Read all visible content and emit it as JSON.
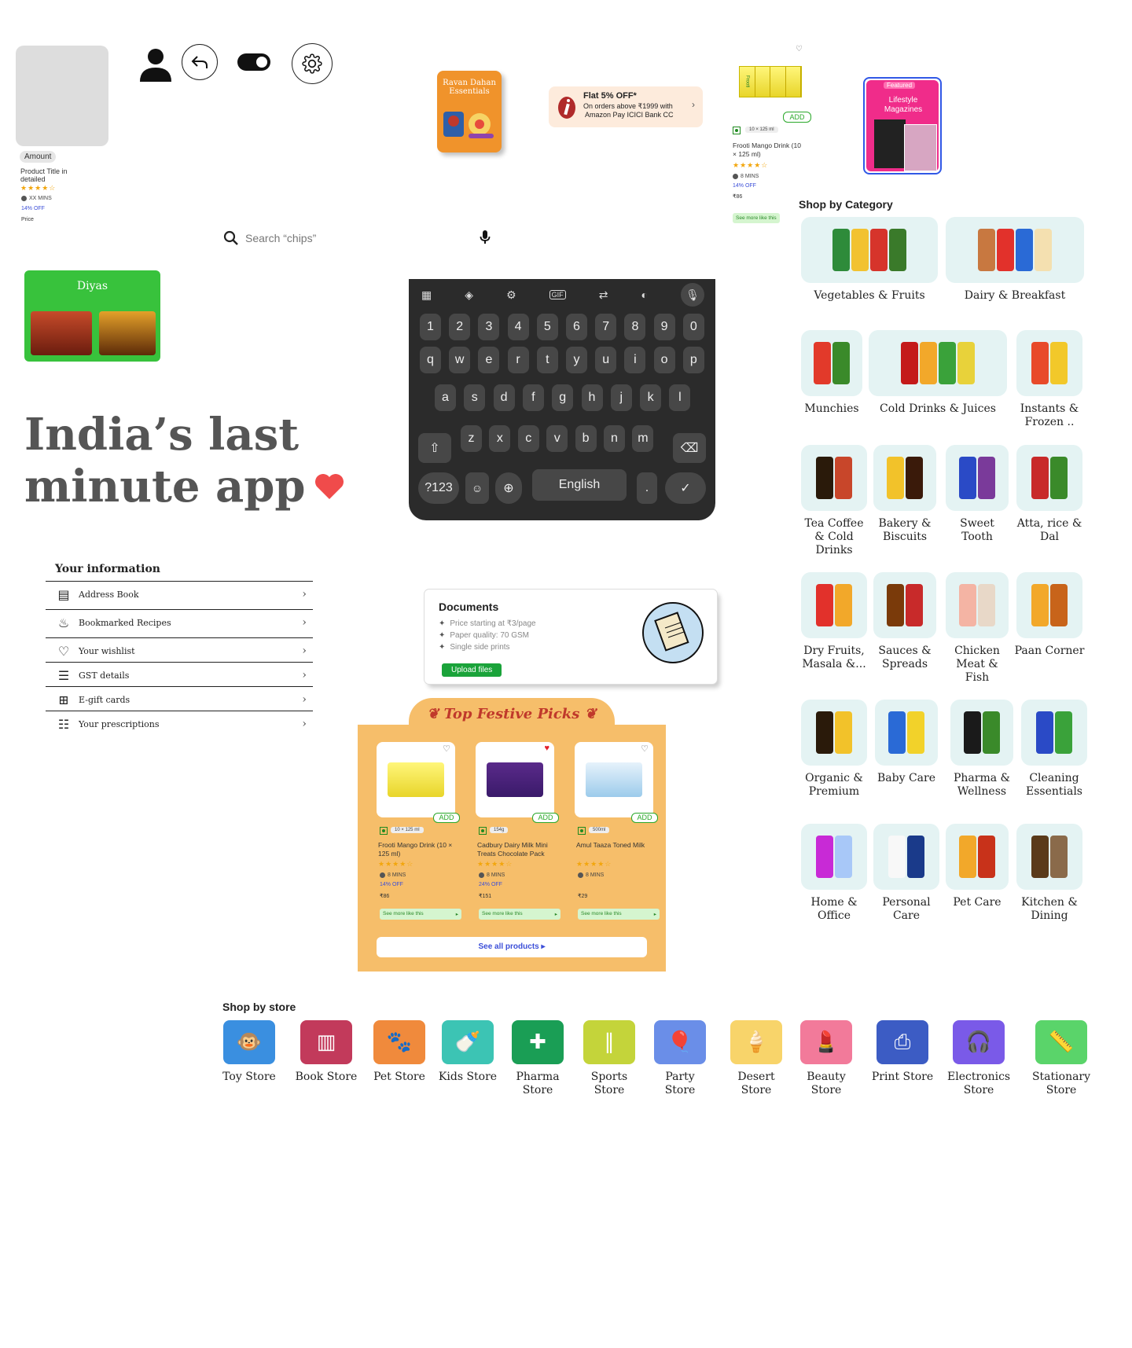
{
  "product_placeholder": {
    "badge": "Amount",
    "title": "Product Title in detailed",
    "rating": "★★★★☆",
    "eta": "XX MINS",
    "discount": "14% OFF",
    "price": "Price"
  },
  "festive_tile": {
    "title": "Ravan Dahan Essentials"
  },
  "offer": {
    "headline": "Flat 5% OFF*",
    "line1": "On orders above ₹1999 with",
    "line2": "Amazon Pay ICICI Bank CC"
  },
  "product_card": {
    "image": "Frooti",
    "add": "ADD",
    "qty": "10 × 125 ml",
    "title": "Frooti Mango Drink (10 × 125 ml)",
    "rating": "★★★★☆",
    "eta": "8 MINS",
    "discount": "14% OFF",
    "price": "₹86",
    "see_more": "See more like this"
  },
  "featured": {
    "badge": "Featured",
    "title": "Lifestyle Magazines"
  },
  "search": {
    "placeholder": "Search “chips”"
  },
  "diyas": {
    "title": "Diyas"
  },
  "hero": {
    "line1": "India’s last",
    "line2": "minute app"
  },
  "keyboard": {
    "numbers": [
      "1",
      "2",
      "3",
      "4",
      "5",
      "6",
      "7",
      "8",
      "9",
      "0"
    ],
    "row1": [
      "q",
      "w",
      "e",
      "r",
      "t",
      "y",
      "u",
      "i",
      "o",
      "p"
    ],
    "row2": [
      "a",
      "s",
      "d",
      "f",
      "g",
      "h",
      "j",
      "k",
      "l"
    ],
    "row3": [
      "z",
      "x",
      "c",
      "v",
      "b",
      "n",
      "m"
    ],
    "sym": "?123",
    "space": "English",
    "period": "."
  },
  "info": {
    "title": "Your information",
    "items": [
      {
        "label": "Address Book"
      },
      {
        "label": "Bookmarked Recipes"
      },
      {
        "label": "Your wishlist"
      },
      {
        "label": "GST details"
      },
      {
        "label": "E-gift cards"
      },
      {
        "label": "Your prescriptions"
      }
    ]
  },
  "documents": {
    "title": "Documents",
    "bullets": [
      "Price starting at ₹3/page",
      "Paper quality: 70 GSM",
      "Single side prints"
    ],
    "button": "Upload files"
  },
  "festive_picks": {
    "title": "Top Festive Picks",
    "products": [
      {
        "qty": "10 × 125 ml",
        "title": "Frooti Mango Drink (10 × 125 ml)",
        "rating": "★★★★☆",
        "eta": "8 MINS",
        "discount": "14% OFF",
        "price": "₹86",
        "add": "ADD",
        "see_more": "See more like this"
      },
      {
        "qty": "154g",
        "title": "Cadbury Dairy Milk Mini Treats Chocolate Pack",
        "rating": "★★★★☆",
        "eta": "8 MINS",
        "discount": "24% OFF",
        "price": "₹151",
        "add": "ADD",
        "see_more": "See more like this"
      },
      {
        "qty": "500ml",
        "title": "Amul Taaza Toned Milk",
        "rating": "★★★★☆",
        "eta": "8 MINS",
        "discount": "",
        "price": "₹29",
        "add": "ADD",
        "see_more": "See more like this"
      }
    ],
    "see_all": "See all products"
  },
  "categories": {
    "title": "Shop by Category",
    "items": [
      {
        "label": "Vegetables & Fruits"
      },
      {
        "label": "Dairy & Breakfast"
      },
      {
        "label": "Munchies"
      },
      {
        "label": "Cold Drinks & Juices"
      },
      {
        "label": "Instants & Frozen .."
      },
      {
        "label": "Tea Coffee & Cold Drinks"
      },
      {
        "label": "Bakery & Biscuits"
      },
      {
        "label": "Sweet Tooth"
      },
      {
        "label": "Atta, rice & Dal"
      },
      {
        "label": "Dry Fruits, Masala &..."
      },
      {
        "label": "Sauces & Spreads"
      },
      {
        "label": "Chicken Meat & Fish"
      },
      {
        "label": "Paan Corner"
      },
      {
        "label": "Organic & Premium"
      },
      {
        "label": "Baby Care"
      },
      {
        "label": "Pharma & Wellness"
      },
      {
        "label": "Cleaning Essentials"
      },
      {
        "label": "Home & Office"
      },
      {
        "label": "Personal Care"
      },
      {
        "label": "Pet Care"
      },
      {
        "label": "Kitchen & Dining"
      }
    ]
  },
  "stores": {
    "title": "Shop by store",
    "items": [
      {
        "label": "Toy Store",
        "color": "#3a8fe0"
      },
      {
        "label": "Book Store",
        "color": "#c23a5b"
      },
      {
        "label": "Pet Store",
        "color": "#f08a3c"
      },
      {
        "label": "Kids Store",
        "color": "#3cc4b4"
      },
      {
        "label": "Pharma Store",
        "color": "#1a9e55"
      },
      {
        "label": "Sports Store",
        "color": "#c4d43a"
      },
      {
        "label": "Party Store",
        "color": "#6a8ee8"
      },
      {
        "label": "Desert Store",
        "color": "#f8d46a"
      },
      {
        "label": "Beauty Store",
        "color": "#f27a9a"
      },
      {
        "label": "Print Store",
        "color": "#3c5cc4"
      },
      {
        "label": "Electronics Store",
        "color": "#7a5ae8"
      },
      {
        "label": "Stationary Store",
        "color": "#5ad46a"
      }
    ]
  }
}
